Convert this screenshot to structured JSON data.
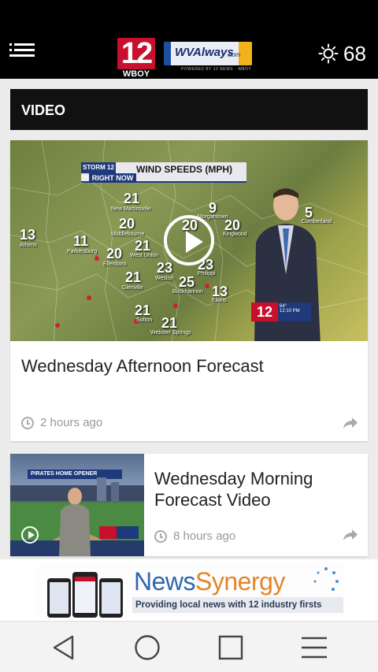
{
  "app": {
    "logo_channel": "12",
    "logo_station": "WBOY",
    "partner_logo": "WVAlways",
    "partner_logo_domain": ".com",
    "partner_logo_caption": "POWERED BY 12 NEWS - WBOY"
  },
  "weather": {
    "icon": "sun-icon",
    "temperature": "68"
  },
  "section": {
    "title": "VIDEO"
  },
  "videos": [
    {
      "title": "Wednesday Afternoon Forecast",
      "time": "2 hours ago",
      "thumbnail": {
        "banner_tag": "STORM 12 TRACKER",
        "banner_title": "WIND SPEEDS (MPH)",
        "banner_sub": "RIGHT NOW",
        "bug_channel": "12",
        "bug_time": "12:10 PM",
        "bug_temp": "64°",
        "map_values": [
          {
            "n": "13",
            "city": "Athens"
          },
          {
            "n": "21",
            "city": "New Martinsville"
          },
          {
            "n": "11",
            "city": "Parkersburg"
          },
          {
            "n": "20",
            "city": "Middlebourne"
          },
          {
            "n": "20",
            "city": "Ellenboro"
          },
          {
            "n": "21",
            "city": "West Union"
          },
          {
            "n": "20",
            "city": ""
          },
          {
            "n": "9",
            "city": "Morgantown"
          },
          {
            "n": "20",
            "city": "Kingwood"
          },
          {
            "n": "21",
            "city": "Glenville"
          },
          {
            "n": "23",
            "city": "Weston"
          },
          {
            "n": "23",
            "city": "Philippi"
          },
          {
            "n": "25",
            "city": "Buckhannon"
          },
          {
            "n": "13",
            "city": "Elkins"
          },
          {
            "n": "21",
            "city": "Sutton"
          },
          {
            "n": "21",
            "city": "Webster Springs"
          },
          {
            "n": "5",
            "city": "Cumberland"
          }
        ]
      }
    },
    {
      "title": "Wednesday Morning Forecast Video",
      "time": "8 hours ago",
      "thumbnail": {
        "banner_title": "PIRATES HOME OPENER"
      }
    }
  ],
  "ad": {
    "brand_part1": "News",
    "brand_part2": "Synergy",
    "tagline": "Providing local news with 12 industry firsts"
  },
  "navigation": {
    "back": "back-icon",
    "home": "home-icon",
    "recents": "recents-icon",
    "menu": "menu-icon"
  },
  "colors": {
    "appbar": "#000000",
    "brand_red": "#c8102e",
    "meta_gray": "#999999"
  }
}
